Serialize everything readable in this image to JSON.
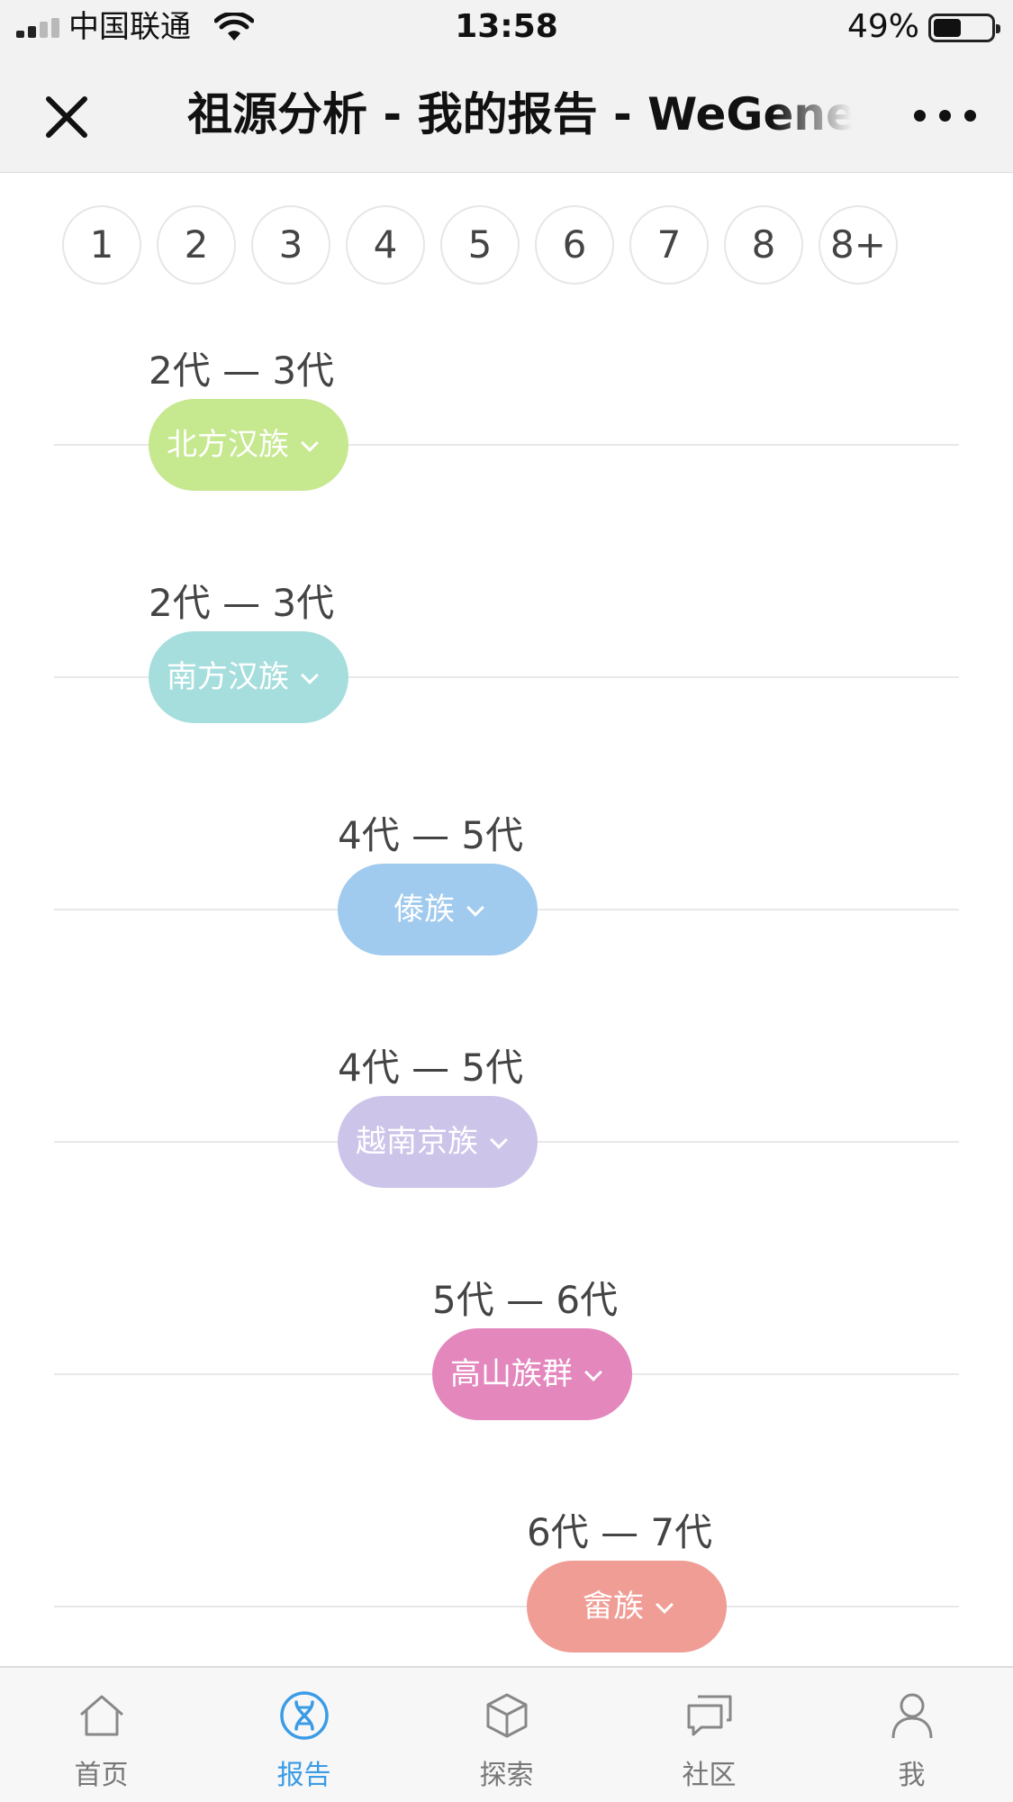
{
  "status_bar": {
    "carrier": "中国联通",
    "time": "13:58",
    "battery_percent": "49%",
    "battery_level": 0.49
  },
  "nav": {
    "title": "祖源分析 - 我的报告 - WeGene",
    "close_icon": "close-icon",
    "more_icon": "more-icon"
  },
  "generations": [
    "1",
    "2",
    "3",
    "4",
    "5",
    "6",
    "7",
    "8",
    "8+"
  ],
  "populations": [
    {
      "generation_range": "2代 — 3代",
      "name": "北方汉族",
      "color": "#c6e88e",
      "from_gen": 2,
      "to_gen": 3
    },
    {
      "generation_range": "2代 — 3代",
      "name": "南方汉族",
      "color": "#a6dedd",
      "from_gen": 2,
      "to_gen": 3
    },
    {
      "generation_range": "4代 — 5代",
      "name": "傣族",
      "color": "#a0caee",
      "from_gen": 4,
      "to_gen": 5
    },
    {
      "generation_range": "4代 — 5代",
      "name": "越南京族",
      "color": "#cdc4ea",
      "from_gen": 4,
      "to_gen": 5
    },
    {
      "generation_range": "5代 — 6代",
      "name": "高山族群",
      "color": "#e387bd",
      "from_gen": 5,
      "to_gen": 6
    },
    {
      "generation_range": "6代 — 7代",
      "name": "畲族",
      "color": "#f09d96",
      "from_gen": 6,
      "to_gen": 7
    }
  ],
  "tabs": [
    {
      "label": "首页",
      "icon": "home-icon",
      "active": false
    },
    {
      "label": "报告",
      "icon": "dna-icon",
      "active": true
    },
    {
      "label": "探索",
      "icon": "cube-icon",
      "active": false
    },
    {
      "label": "社区",
      "icon": "chat-icon",
      "active": false
    },
    {
      "label": "我",
      "icon": "profile-icon",
      "active": false
    }
  ],
  "colors": {
    "accent": "#3a9be6",
    "tab_inactive": "#777777",
    "bar_background": "#f2f2f2"
  }
}
